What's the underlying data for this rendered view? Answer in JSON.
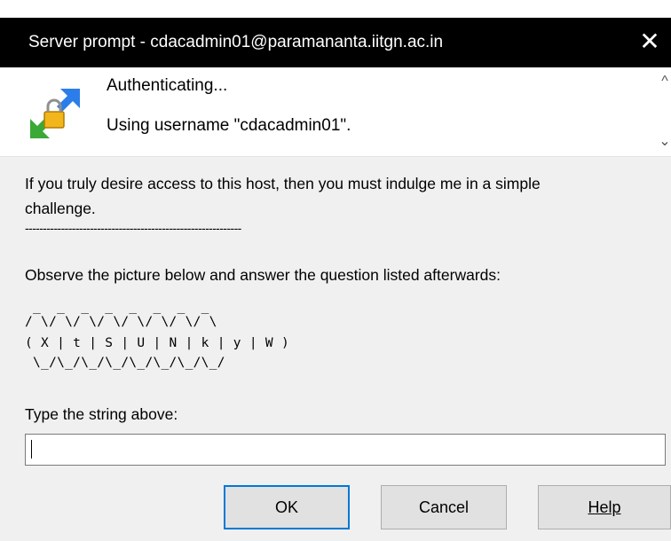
{
  "window": {
    "title": "Server prompt - cdacadmin01@paramananta.iitgn.ac.in",
    "close_glyph": "✕"
  },
  "banner": {
    "icon": "key-exchange-icon",
    "line1": "Authenticating...",
    "line2": "Using username \"cdacadmin01\".",
    "scroll_up": "^",
    "scroll_down": "⌄"
  },
  "prompt": {
    "line1": "If you truly desire access to this host, then you must indulge me in a simple",
    "line2": "challenge.",
    "separator": "------------------------------------------------------------",
    "instruction": "Observe the picture below and answer the question listed afterwards:",
    "captcha_lines": [
      " _  _  _  _  _  _  _  _",
      "/ \\/ \\/ \\/ \\/ \\/ \\/ \\/ \\",
      "( X | t | S | U | N | k | y | W )",
      " \\_/\\_/\\_/\\_/\\_/\\_/\\_/\\_/"
    ],
    "question": "Type the string above:",
    "input_value": ""
  },
  "buttons": {
    "ok": "OK",
    "cancel": "Cancel",
    "help": "Help"
  }
}
